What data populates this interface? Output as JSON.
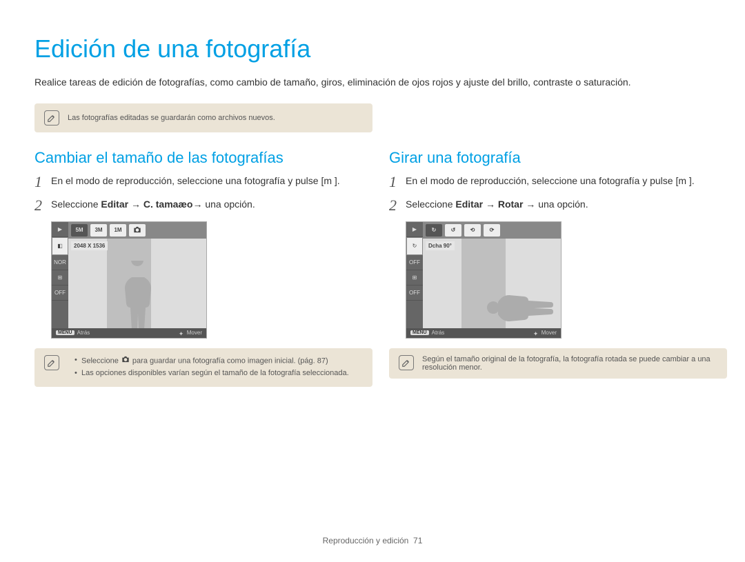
{
  "title": "Edición de una fotografía",
  "intro": "Realice tareas de edición de fotografías, como cambio de tamaño, giros, eliminación de ojos rojos y ajuste del brillo, contraste o saturación.",
  "top_note": "Las fotografías editadas se guardarán como archivos nuevos.",
  "left": {
    "heading": "Cambiar el tamaño de las fotografías",
    "step1": {
      "num": "1",
      "text": "En el modo de reproducción, seleccione una fotografía y pulse [m        ]."
    },
    "step2": {
      "num": "2",
      "prefix": "Seleccione ",
      "editar": "Editar",
      "arrow1": " → ",
      "action": "C. tamaæo",
      "arrow2": "→ ",
      "suffix": "una opción."
    },
    "screen": {
      "topbar": [
        "5M",
        "3M",
        "1M",
        ""
      ],
      "label": "2048 X 1536",
      "footer": {
        "left_badge": "MENU",
        "left": "Atrás",
        "right": "Mover"
      }
    },
    "note": {
      "item1_prefix": "Seleccione ",
      "item1_suffix": " para guardar una fotografía como imagen inicial. (pág. 87)",
      "item2": "Las opciones disponibles varían según el tamaño de la fotografía seleccionada."
    }
  },
  "right": {
    "heading": "Girar una fotografía",
    "step1": {
      "num": "1",
      "text": "En el modo de reproducción, seleccione una fotografía y pulse [m        ]."
    },
    "step2": {
      "num": "2",
      "prefix": "Seleccione ",
      "editar": "Editar",
      "arrow1": " → ",
      "action": "Rotar",
      "arrow2": " → ",
      "suffix": "una opción."
    },
    "screen": {
      "label": "Dcha 90°",
      "footer": {
        "left_badge": "MENU",
        "left": "Atrás",
        "right": "Mover"
      }
    },
    "note": "Según el tamaño original de la fotografía, la fotografía rotada se puede cambiar a una resolución menor."
  },
  "footer": {
    "section": "Reproducción y edición",
    "page": "71"
  },
  "icons": {
    "note": "pencil-icon",
    "camera": "camera-icon",
    "rotate": "rotate-icon",
    "play": "play-icon"
  }
}
